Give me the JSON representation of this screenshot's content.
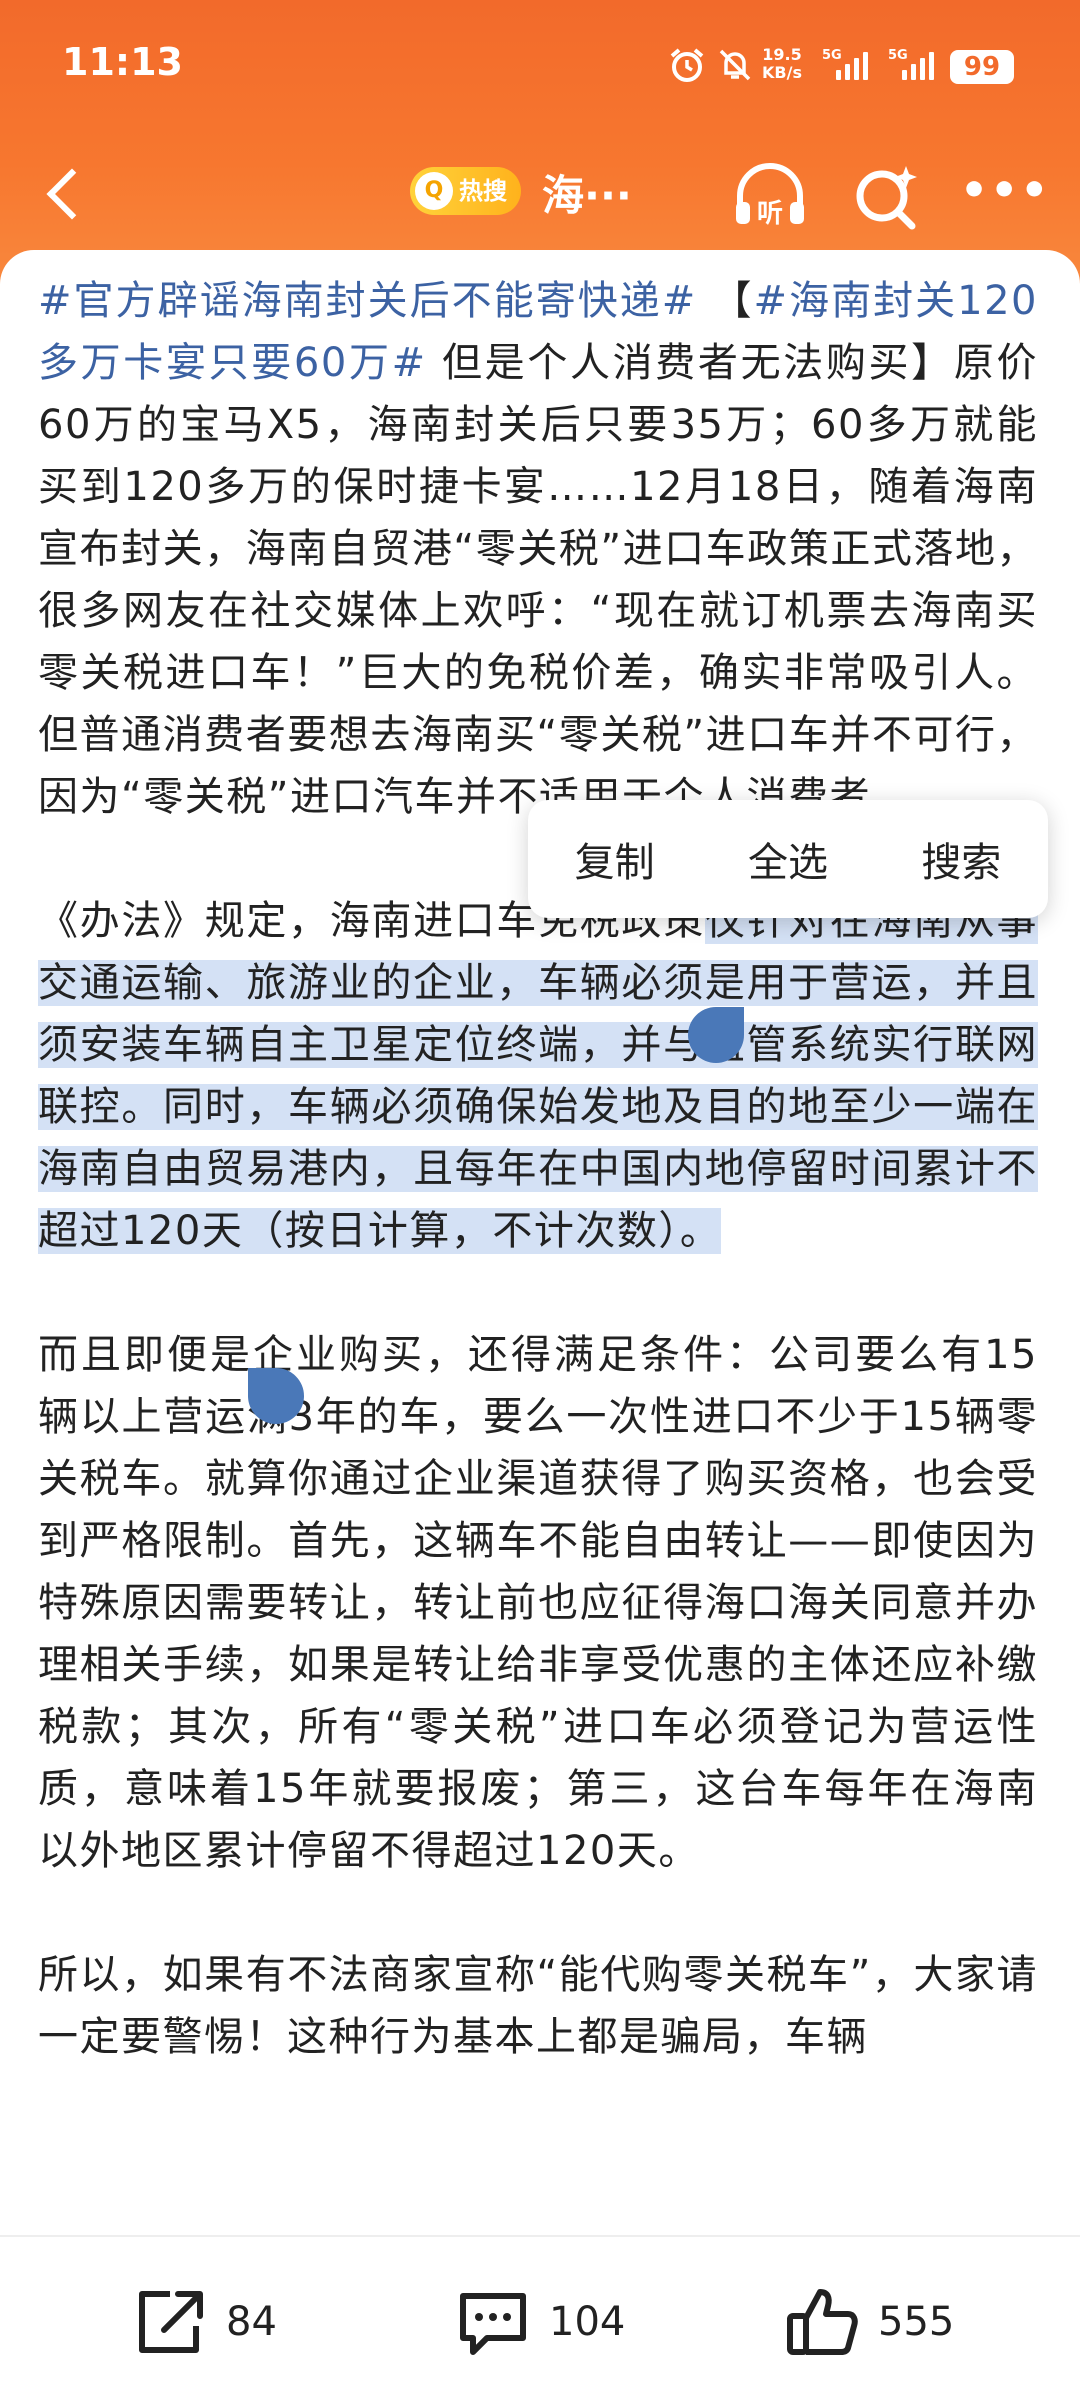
{
  "status_bar": {
    "time": "11:13",
    "net_speed_value": "19.5",
    "net_speed_unit": "KB/s",
    "sim1_label": "5G",
    "sim2_label": "5G",
    "battery_level": "99"
  },
  "header": {
    "hot_badge_label": "热搜",
    "title": "海···",
    "listen_label": "听"
  },
  "article": {
    "p1_tag1": "#官方辟谣海南封关后不能寄快递#",
    "p1_tag2_open": " 【",
    "p1_tag2": "#海南封关120多万卡宴只要60万#",
    "p1_text": " 但是个人消费者无法购买】原价60万的宝马X5，海南封关后只要35万；60多万就能买到120多万的保时捷卡宴……12月18日，随着海南宣布封关，海南自贸港“零关税”进口车政策正式落地，很多网友在社交媒体上欢呼：“现在就订机票去海南买零关税进口车！”巨大的免税价差，确实非常吸引人。但普通消费者要想去海南买“零关税”进口车并不可行，因为“零关税”进口汽车并不适用于个人消费者。",
    "p2_text": "《办法》规定，海南进口车免税政策",
    "p2_selected": "仅针对在海南从事交通运输、旅游业的企业，车辆必须是用于营运，并且须安装车辆自主卫星定位终端，并与监管系统实行联网联控。同时，车辆必须确保始发地及目的地至少一端在海南自由贸易港内，且每年在中国内地停留时间累计不超过120天（按日计算，不计次数）。",
    "p3_text": "而且即便是企业购买，还得满足条件：公司要么有15辆以上营运满3年的车，要么一次性进口不少于15辆零关税车。就算你通过企业渠道获得了购买资格，也会受到严格限制。首先，这辆车不能自由转让——即使因为特殊原因需要转让，转让前也应征得海口海关同意并办理相关手续，如果是转让给非享受优惠的主体还应补缴税款；其次，所有“零关税”进口车必须登记为营运性质，意味着15年就要报废；第三，这台车每年在海南以外地区累计停留不得超过120天。",
    "p4_text": "所以，如果有不法商家宣称“能代购零关税车”，大家请一定要警惕！这种行为基本上都是骗局，车辆"
  },
  "context_menu": {
    "copy": "复制",
    "select_all": "全选",
    "search": "搜索"
  },
  "actions": {
    "share_count": "84",
    "comment_count": "104",
    "like_count": "555"
  },
  "colors": {
    "header_orange": "#f26a2b",
    "hashtag_blue": "#3c62a3",
    "selection_bg": "#d4e1f5",
    "handle_blue": "#4a78b8"
  }
}
